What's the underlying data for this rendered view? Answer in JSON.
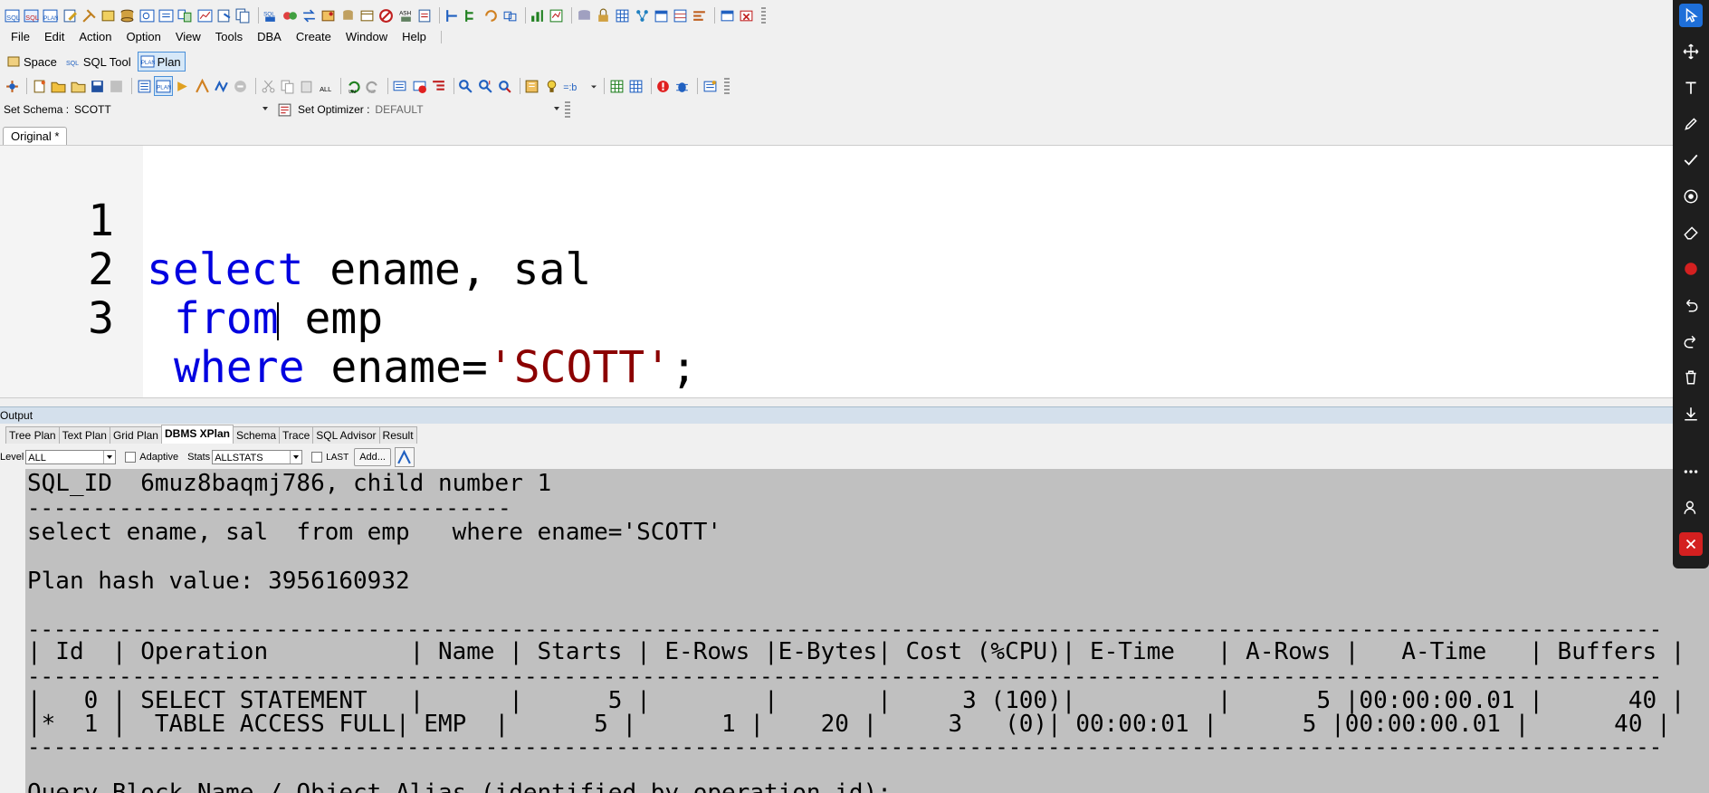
{
  "menu": [
    "File",
    "Edit",
    "Action",
    "Option",
    "View",
    "Tools",
    "DBA",
    "Create",
    "Window",
    "Help"
  ],
  "modes": [
    {
      "label": "Space",
      "active": false,
      "icon": "space-icon"
    },
    {
      "label": "SQL Tool",
      "active": false,
      "icon": "sql-tool-icon"
    },
    {
      "label": "Plan",
      "active": true,
      "icon": "plan-icon"
    }
  ],
  "schema": {
    "label": "Set Schema :",
    "value": "SCOTT"
  },
  "optimizer": {
    "label": "Set Optimizer :",
    "value": "DEFAULT"
  },
  "editor": {
    "tab": "Original *",
    "lines": [
      {
        "num": "1",
        "kw": "select",
        "rest": " ename, sal"
      },
      {
        "num": "2",
        "kw": "from",
        "rest": " emp"
      },
      {
        "num": "3",
        "kw": "where",
        "mid": " ename=",
        "str": "'SCOTT'",
        "end": ";"
      }
    ]
  },
  "output": {
    "title": "Output",
    "tabs": [
      "Tree Plan",
      "Text Plan",
      "Grid Plan",
      "DBMS XPlan",
      "Schema",
      "Trace",
      "SQL Advisor",
      "Result"
    ],
    "active_tab": "DBMS XPlan",
    "level_label": "Level",
    "level_value": "ALL",
    "adaptive_label": "Adaptive",
    "stats_label": "Stats",
    "stats_value": "ALLSTATS",
    "last_label": "LAST",
    "add_label": "Add..."
  },
  "xplan": {
    "sql_id_line": "SQL_ID  6muz8baqmj786, child number 1",
    "sep1": "-------------------------------------",
    "sql_text": "select ename, sal  from emp   where ename='SCOTT'",
    "plan_hash": "Plan hash value: 3956160932",
    "sep_long": "-----------------------------------------------------------------------------------------------------------------------------",
    "header": "| Id  | Operation          | Name | Starts | E-Rows |E-Bytes| Cost (%CPU)| E-Time   | A-Rows |   A-Time   | Buffers |",
    "row0": "|   0 | SELECT STATEMENT   |      |      5 |        |       |     3 (100)|          |      5 |00:00:00.01 |      40 |",
    "row1": "|*  1 |  TABLE ACCESS FULL| EMP  |      5 |      1 |    20 |     3   (0)| 00:00:01 |      5 |00:00:00.01 |      40 |",
    "cut_line": "Query Block Name / Object Alias (identified by operation id):"
  }
}
